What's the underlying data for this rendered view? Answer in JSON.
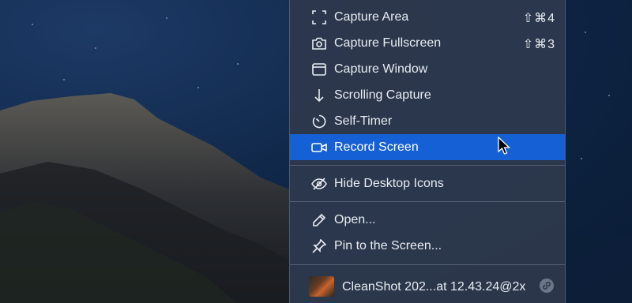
{
  "menu": {
    "items": [
      {
        "label": "Capture Area",
        "icon": "capture-area-icon",
        "shortcut": "⇧⌘4"
      },
      {
        "label": "Capture Fullscreen",
        "icon": "camera-icon",
        "shortcut": "⇧⌘3"
      },
      {
        "label": "Capture Window",
        "icon": "window-icon",
        "shortcut": ""
      },
      {
        "label": "Scrolling Capture",
        "icon": "down-arrow-icon",
        "shortcut": ""
      },
      {
        "label": "Self-Timer",
        "icon": "timer-icon",
        "shortcut": ""
      },
      {
        "label": "Record Screen",
        "icon": "video-camera-icon",
        "shortcut": "",
        "highlighted": true
      },
      {
        "label": "Hide Desktop Icons",
        "icon": "eye-slash-icon",
        "shortcut": ""
      },
      {
        "label": "Open...",
        "icon": "pencil-icon",
        "shortcut": ""
      },
      {
        "label": "Pin to the Screen...",
        "icon": "pin-icon",
        "shortcut": ""
      }
    ],
    "recent": {
      "label": "CleanShot 202...at 12.43.24@2x",
      "icon": "link-icon"
    },
    "highlight_color": "#1560d4"
  }
}
